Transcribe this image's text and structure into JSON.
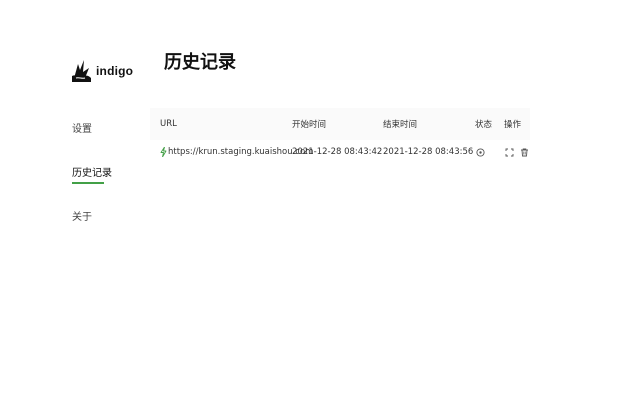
{
  "app": {
    "name": "indigo"
  },
  "sidebar": {
    "items": [
      {
        "label": "设置",
        "active": false
      },
      {
        "label": "历史记录",
        "active": true
      },
      {
        "label": "关于",
        "active": false
      }
    ],
    "active_color": "#43a047"
  },
  "main": {
    "title": "历史记录",
    "table": {
      "headers": {
        "url": "URL",
        "start": "开始时间",
        "end": "结束时间",
        "status": "状态",
        "actions": "操作"
      },
      "rows": [
        {
          "url": "https://krun.staging.kuaishou.com",
          "start": "2021-12-28 08:43:42",
          "end": "2021-12-28 08:43:56",
          "status_icon": "target-icon",
          "action_icons": [
            "expand-icon",
            "trash-icon"
          ]
        }
      ]
    }
  }
}
